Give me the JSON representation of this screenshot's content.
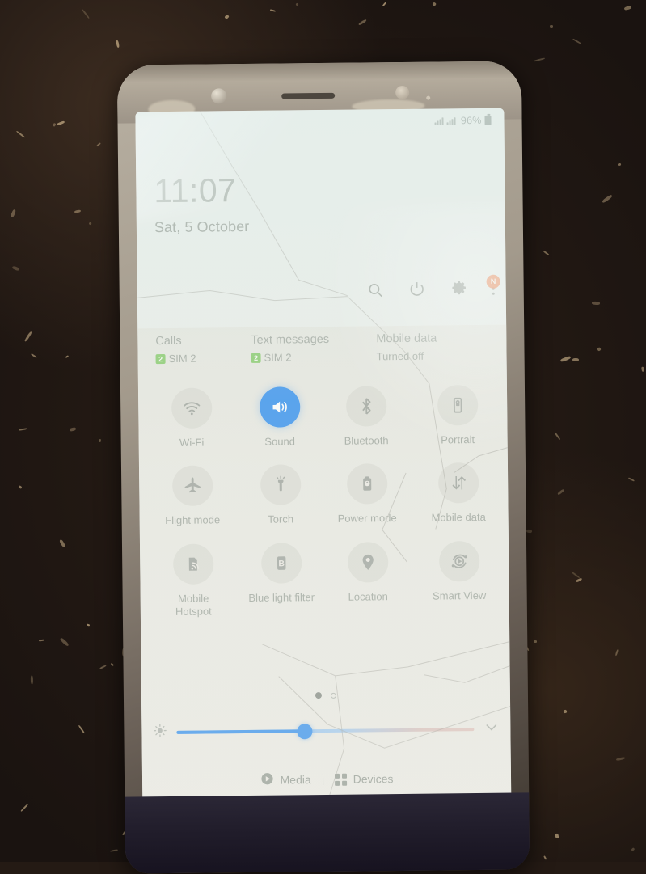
{
  "status_bar": {
    "battery_percent": "96%",
    "signal_icon": "signal-bars-icon",
    "battery_icon": "battery-full-icon"
  },
  "lock_screen": {
    "time": "11:07",
    "date": "Sat, 5 October"
  },
  "action_row": {
    "items": [
      {
        "name": "search-icon",
        "label": "Search"
      },
      {
        "name": "power-icon",
        "label": "Power off"
      },
      {
        "name": "gear-icon",
        "label": "Settings"
      },
      {
        "name": "more-options-icon",
        "label": "More options"
      }
    ],
    "badge_text": "N",
    "badge_color": "#f0763c"
  },
  "sim_summary": [
    {
      "title": "Calls",
      "sub": "SIM 2",
      "badge": "2",
      "has_badge": true
    },
    {
      "title": "Text messages",
      "sub": "SIM 2",
      "badge": "2",
      "has_badge": true
    },
    {
      "title": "Mobile data",
      "sub": "Turned off",
      "badge": "",
      "has_badge": false
    }
  ],
  "quick_settings": {
    "tiles": [
      {
        "label": "Wi-Fi",
        "icon": "wifi-icon",
        "active": false
      },
      {
        "label": "Sound",
        "icon": "sound-speaker-icon",
        "active": true
      },
      {
        "label": "Bluetooth",
        "icon": "bluetooth-icon",
        "active": false
      },
      {
        "label": "Portrait",
        "icon": "rotation-lock-icon",
        "active": false
      },
      {
        "label": "Flight mode",
        "icon": "airplane-icon",
        "active": false
      },
      {
        "label": "Torch",
        "icon": "flashlight-icon",
        "active": false
      },
      {
        "label": "Power mode",
        "icon": "battery-power-mode-icon",
        "active": false
      },
      {
        "label": "Mobile data",
        "icon": "data-arrows-icon",
        "active": false
      },
      {
        "label": "Mobile Hotspot",
        "icon": "hotspot-icon",
        "active": false
      },
      {
        "label": "Blue light filter",
        "icon": "blue-light-filter-icon",
        "active": false
      },
      {
        "label": "Location",
        "icon": "location-pin-icon",
        "active": false
      },
      {
        "label": "Smart View",
        "icon": "smart-view-icon",
        "active": false
      }
    ],
    "active_color": "#2b8cf0",
    "page_current": 1,
    "page_total": 2
  },
  "brightness": {
    "icon": "brightness-icon",
    "value_percent": 43,
    "expand_icon": "chevron-down-icon"
  },
  "footer": {
    "media_label": "Media",
    "media_icon": "play-circle-icon",
    "devices_label": "Devices",
    "devices_icon": "grid-dots-icon",
    "divider": "|"
  }
}
